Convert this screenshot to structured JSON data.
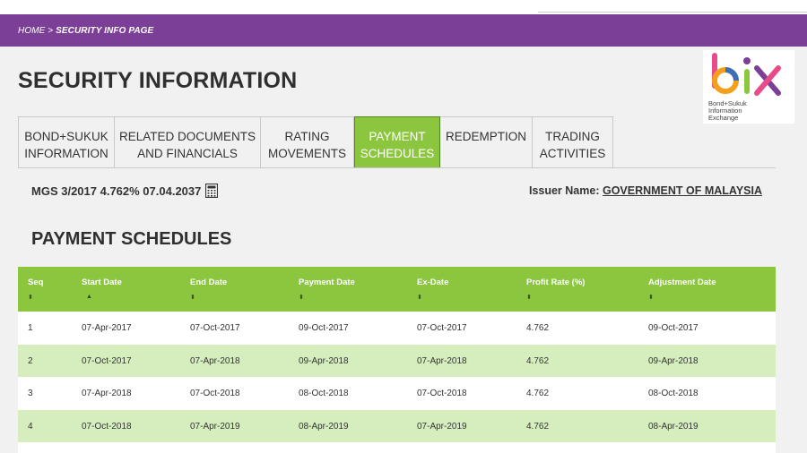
{
  "breadcrumb": {
    "home": "HOME",
    "separator": " > ",
    "current": "SECURITY INFO PAGE"
  },
  "page_title": "SECURITY INFORMATION",
  "logo": {
    "brand": "bix",
    "tagline_1": "Bond+Sukuk",
    "tagline_2": "Information",
    "tagline_3": "Exchange"
  },
  "tabs": [
    {
      "line1": "BOND+SUKUK",
      "line2": "INFORMATION",
      "active": false
    },
    {
      "line1": "RELATED DOCUMENTS",
      "line2": "AND FINANCIALS",
      "active": false
    },
    {
      "line1": "RATING",
      "line2": "MOVEMENTS",
      "active": false
    },
    {
      "line1": "PAYMENT",
      "line2": "SCHEDULES",
      "active": true
    },
    {
      "line1": "REDEMPTION",
      "line2": "",
      "active": false
    },
    {
      "line1": "TRADING",
      "line2": "ACTIVITIES",
      "active": false
    }
  ],
  "security": {
    "name": "MGS 3/2017 4.762% 07.04.2037",
    "icon": "calculator-icon"
  },
  "issuer": {
    "label": "Issuer Name:",
    "value": "GOVERNMENT OF MALAYSIA"
  },
  "section_title": "PAYMENT SCHEDULES",
  "table": {
    "columns": [
      "Seq",
      "Start Date",
      "End Date",
      "Payment Date",
      "Ex-Date",
      "Profit Rate (%)",
      "Adjustment Date"
    ],
    "sort_indicators": [
      "⬍",
      "▲",
      "⬍",
      "⬍",
      "⬍",
      "⬍",
      "⬍"
    ],
    "rows": [
      [
        "1",
        "07-Apr-2017",
        "07-Oct-2017",
        "09-Oct-2017",
        "07-Oct-2017",
        "4.762",
        "09-Oct-2017"
      ],
      [
        "2",
        "07-Oct-2017",
        "07-Apr-2018",
        "09-Apr-2018",
        "07-Apr-2018",
        "4.762",
        "09-Apr-2018"
      ],
      [
        "3",
        "07-Apr-2018",
        "07-Oct-2018",
        "08-Oct-2018",
        "07-Oct-2018",
        "4.762",
        "08-Oct-2018"
      ],
      [
        "4",
        "07-Oct-2018",
        "07-Apr-2019",
        "08-Apr-2019",
        "07-Apr-2019",
        "4.762",
        "08-Apr-2019"
      ]
    ]
  },
  "colors": {
    "purple": "#7b3f97",
    "green": "#8cc63f",
    "green_light": "#d6eebd"
  }
}
